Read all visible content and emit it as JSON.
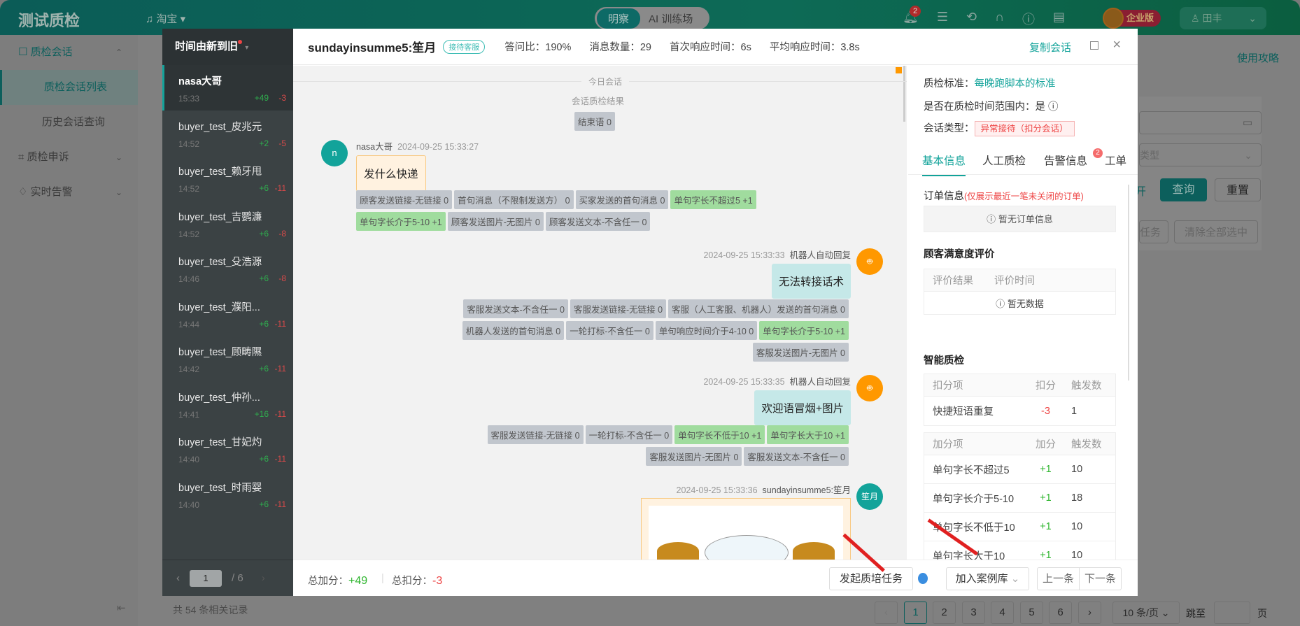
{
  "app": {
    "logo": "测试质检",
    "shop": "淘宝",
    "mode_active": "明察",
    "mode_other": "AI 训练场",
    "notif_count": "2",
    "edition": "企业版",
    "user": "田丰",
    "guide": "使用攻略"
  },
  "sidebar": {
    "items": [
      {
        "label": "质检会话",
        "expanded": true,
        "children": [
          "质检会话列表",
          "历史会话查询"
        ]
      },
      {
        "label": "质检申诉"
      },
      {
        "label": "实时告警"
      }
    ]
  },
  "background": {
    "query": "查询",
    "reset": "重置",
    "clear_all": "清除全部选中",
    "task_partial": "任务",
    "type_placeholder": "类型",
    "expand_partial": "开",
    "total_records": "共 54 条相关记录",
    "pages": [
      "1",
      "2",
      "3",
      "4",
      "5",
      "6"
    ],
    "per_page": "10 条/页",
    "jump_to": "跳至",
    "page_unit": "页"
  },
  "conv_list": {
    "sort_label": "时间由新到旧",
    "items": [
      {
        "name": "nasa大哥",
        "time": "15:33",
        "plus": "+49",
        "minus": "-3"
      },
      {
        "name": "buyer_test_皮兆元",
        "time": "14:52",
        "plus": "+2",
        "minus": "-5"
      },
      {
        "name": "buyer_test_赖牙甩",
        "time": "14:52",
        "plus": "+6",
        "minus": "-11"
      },
      {
        "name": "buyer_test_吉鹦濂",
        "time": "14:52",
        "plus": "+6",
        "minus": "-8"
      },
      {
        "name": "buyer_test_殳浩源",
        "time": "14:46",
        "plus": "+6",
        "minus": "-8"
      },
      {
        "name": "buyer_test_濮阳...",
        "time": "14:44",
        "plus": "+6",
        "minus": "-11"
      },
      {
        "name": "buyer_test_顾畴隰",
        "time": "14:42",
        "plus": "+6",
        "minus": "-11"
      },
      {
        "name": "buyer_test_仲孙...",
        "time": "14:41",
        "plus": "+16",
        "minus": "-11"
      },
      {
        "name": "buyer_test_甘妃灼",
        "time": "14:40",
        "plus": "+6",
        "minus": "-11"
      },
      {
        "name": "buyer_test_时雨婴",
        "time": "14:40",
        "plus": "+6",
        "minus": "-11"
      }
    ],
    "page": "1",
    "total_pages": "6"
  },
  "header": {
    "title": "sundayinsumme5:笙月",
    "tag": "接待客服",
    "stats": [
      "答问比：190%",
      "消息数量：29",
      "首次响应时间：6s",
      "平均响应时间：3.8s"
    ],
    "copy": "复制会话"
  },
  "chat": {
    "today": "今日会话",
    "result_label": "会话质检结果",
    "result_tags": [
      {
        "t": "结束语 0",
        "g": false
      }
    ],
    "messages": [
      {
        "sender": "nasa大哥",
        "avatar": "n",
        "time": "2024-09-25 15:33:27",
        "text": "发什么快递",
        "tags": [
          {
            "t": "顾客发送链接-无链接 0",
            "g": false
          },
          {
            "t": "首句消息（不限制发送方） 0",
            "g": false
          },
          {
            "t": "买家发送的首句消息 0",
            "g": false
          },
          {
            "t": "单句字长不超过5 +1",
            "g": true
          },
          {
            "t": "单句字长介于5-10 +1",
            "g": true
          },
          {
            "t": "顾客发送图片-无图片 0",
            "g": false
          },
          {
            "t": "顾客发送文本-不含任一 0",
            "g": false
          }
        ]
      },
      {
        "sender": "机器人自动回复",
        "time": "2024-09-25 15:33:33",
        "text": "无法转接话术",
        "tags": [
          {
            "t": "客服发送文本-不含任一 0",
            "g": false
          },
          {
            "t": "客服发送链接-无链接 0",
            "g": false
          },
          {
            "t": "客服（人工客服、机器人）发送的首句消息 0",
            "g": false
          },
          {
            "t": "机器人发送的首句消息 0",
            "g": false
          },
          {
            "t": "一轮打标-不含任一 0",
            "g": false
          },
          {
            "t": "单句响应时间介于4-10 0",
            "g": false
          },
          {
            "t": "单句字长介于5-10 +1",
            "g": true
          },
          {
            "t": "客服发送图片-无图片 0",
            "g": false
          }
        ]
      },
      {
        "sender": "机器人自动回复",
        "time": "2024-09-25 15:33:35",
        "text": "欢迎语冒烟+图片",
        "tags": [
          {
            "t": "客服发送链接-无链接 0",
            "g": false
          },
          {
            "t": "一轮打标-不含任一 0",
            "g": false
          },
          {
            "t": "单句字长不低于10 +1",
            "g": true
          },
          {
            "t": "单句字长大于10 +1",
            "g": true
          },
          {
            "t": "客服发送图片-无图片 0",
            "g": false
          },
          {
            "t": "客服发送文本-不含任一 0",
            "g": false
          }
        ]
      },
      {
        "sender": "sundayinsumme5:笙月",
        "avatar": "笙月",
        "time": "2024-09-25 15:33:36"
      }
    ]
  },
  "info": {
    "standard_label": "质检标准：",
    "standard_value": "每晚跑脚本的标准",
    "in_range": "是否在质检时间范围内：是",
    "type_label": "会话类型：",
    "type_value": "异常接待（扣分会话）",
    "tabs": [
      "基本信息",
      "人工质检",
      "告警信息",
      "工单"
    ],
    "alert_count": "2",
    "order_title": "订单信息",
    "order_note": "(仅展示最近一笔未关闭的订单)",
    "order_empty": "暂无订单信息",
    "satisfaction_title": "顾客满意度评价",
    "sat_cols": [
      "评价结果",
      "评价时间"
    ],
    "sat_empty": "暂无数据",
    "smart_title": "智能质检",
    "deduct_cols": [
      "扣分项",
      "扣分",
      "触发数"
    ],
    "deduct_rows": [
      [
        "快捷短语重复",
        "-3",
        "1"
      ]
    ],
    "add_cols": [
      "加分项",
      "加分",
      "触发数"
    ],
    "add_rows": [
      [
        "单句字长不超过5",
        "+1",
        "10"
      ],
      [
        "单句字长介于5-10",
        "+1",
        "18"
      ],
      [
        "单句字长不低于10",
        "+1",
        "10"
      ],
      [
        "单句字长大于10",
        "+1",
        "10"
      ]
    ]
  },
  "footer": {
    "plus_label": "总加分：",
    "plus": "+49",
    "minus_label": "总扣分：",
    "minus": "-3",
    "train_task": "发起质培任务",
    "add_case": "加入案例库",
    "prev": "上一条",
    "next": "下一条"
  }
}
